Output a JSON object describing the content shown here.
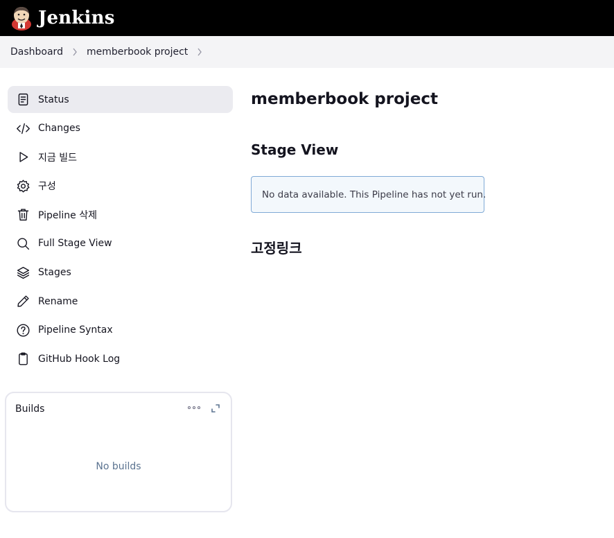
{
  "header": {
    "logo_text": "Jenkins"
  },
  "breadcrumbs": [
    "Dashboard",
    "memberbook project"
  ],
  "sidebar": {
    "items": [
      {
        "label": "Status",
        "icon": "document-icon",
        "active": true
      },
      {
        "label": "Changes",
        "icon": "code-icon"
      },
      {
        "label": "지금 빌드",
        "icon": "play-icon"
      },
      {
        "label": "구성",
        "icon": "gear-icon"
      },
      {
        "label": "Pipeline 삭제",
        "icon": "trash-icon"
      },
      {
        "label": "Full Stage View",
        "icon": "search-icon"
      },
      {
        "label": "Stages",
        "icon": "layers-icon"
      },
      {
        "label": "Rename",
        "icon": "pencil-icon"
      },
      {
        "label": "Pipeline Syntax",
        "icon": "help-circle-icon"
      },
      {
        "label": "GitHub Hook Log",
        "icon": "clipboard-icon"
      }
    ]
  },
  "builds": {
    "title": "Builds",
    "empty_text": "No builds"
  },
  "main": {
    "title": "memberbook project",
    "stage_view_title": "Stage View",
    "stage_view_notice": "No data available. This Pipeline has not yet run.",
    "permalinks_title": "고정링크"
  },
  "colors": {
    "topbar": "#000000",
    "breadcrumb_bg": "#f4f4f6",
    "active_item_bg": "#ebebf0",
    "notice_border": "#7fa9d6",
    "notice_bg": "#f3f8fc",
    "builds_empty_text": "#5b7390"
  }
}
